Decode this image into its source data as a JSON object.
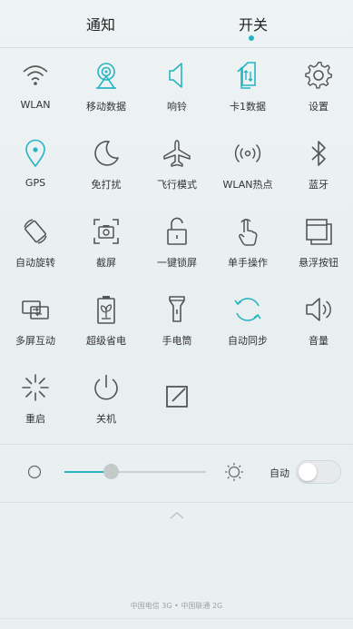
{
  "tabs": {
    "notify": "通知",
    "switch": "开关",
    "active": "开关"
  },
  "tiles": [
    {
      "label": "WLAN",
      "icon": "wifi-icon",
      "active": false
    },
    {
      "label": "移动数据",
      "icon": "mobile-data-icon",
      "active": true
    },
    {
      "label": "响铃",
      "icon": "ringer-icon",
      "active": true
    },
    {
      "label": "卡1数据",
      "icon": "sim-data-icon",
      "active": true
    },
    {
      "label": "设置",
      "icon": "gear-icon",
      "active": false
    },
    {
      "label": "GPS",
      "icon": "location-pin-icon",
      "active": true
    },
    {
      "label": "免打扰",
      "icon": "moon-icon",
      "active": false
    },
    {
      "label": "飞行模式",
      "icon": "airplane-icon",
      "active": false
    },
    {
      "label": "WLAN热点",
      "icon": "hotspot-icon",
      "active": false
    },
    {
      "label": "蓝牙",
      "icon": "bluetooth-icon",
      "active": false
    },
    {
      "label": "自动旋转",
      "icon": "rotate-icon",
      "active": false
    },
    {
      "label": "截屏",
      "icon": "screenshot-icon",
      "active": false
    },
    {
      "label": "一键锁屏",
      "icon": "unlock-icon",
      "active": false
    },
    {
      "label": "单手操作",
      "icon": "hand-icon",
      "active": false
    },
    {
      "label": "悬浮按钮",
      "icon": "floating-button-icon",
      "active": false
    },
    {
      "label": "多屏互动",
      "icon": "multiscreen-icon",
      "active": false
    },
    {
      "label": "超级省电",
      "icon": "battery-saver-icon",
      "active": false
    },
    {
      "label": "手电筒",
      "icon": "flashlight-icon",
      "active": false
    },
    {
      "label": "自动同步",
      "icon": "sync-icon",
      "active": true
    },
    {
      "label": "音量",
      "icon": "volume-icon",
      "active": false
    },
    {
      "label": "重启",
      "icon": "restart-icon",
      "active": false
    },
    {
      "label": "关机",
      "icon": "power-icon",
      "active": false
    },
    {
      "label": "",
      "icon": "edit-icon",
      "active": false
    }
  ],
  "brightness": {
    "level": 0.25,
    "auto_label": "自动",
    "auto_on": false
  },
  "carrier": "中国电信 3G • 中国联通 2G",
  "colors": {
    "accent": "#26b5c2",
    "inactive": "#555555"
  }
}
